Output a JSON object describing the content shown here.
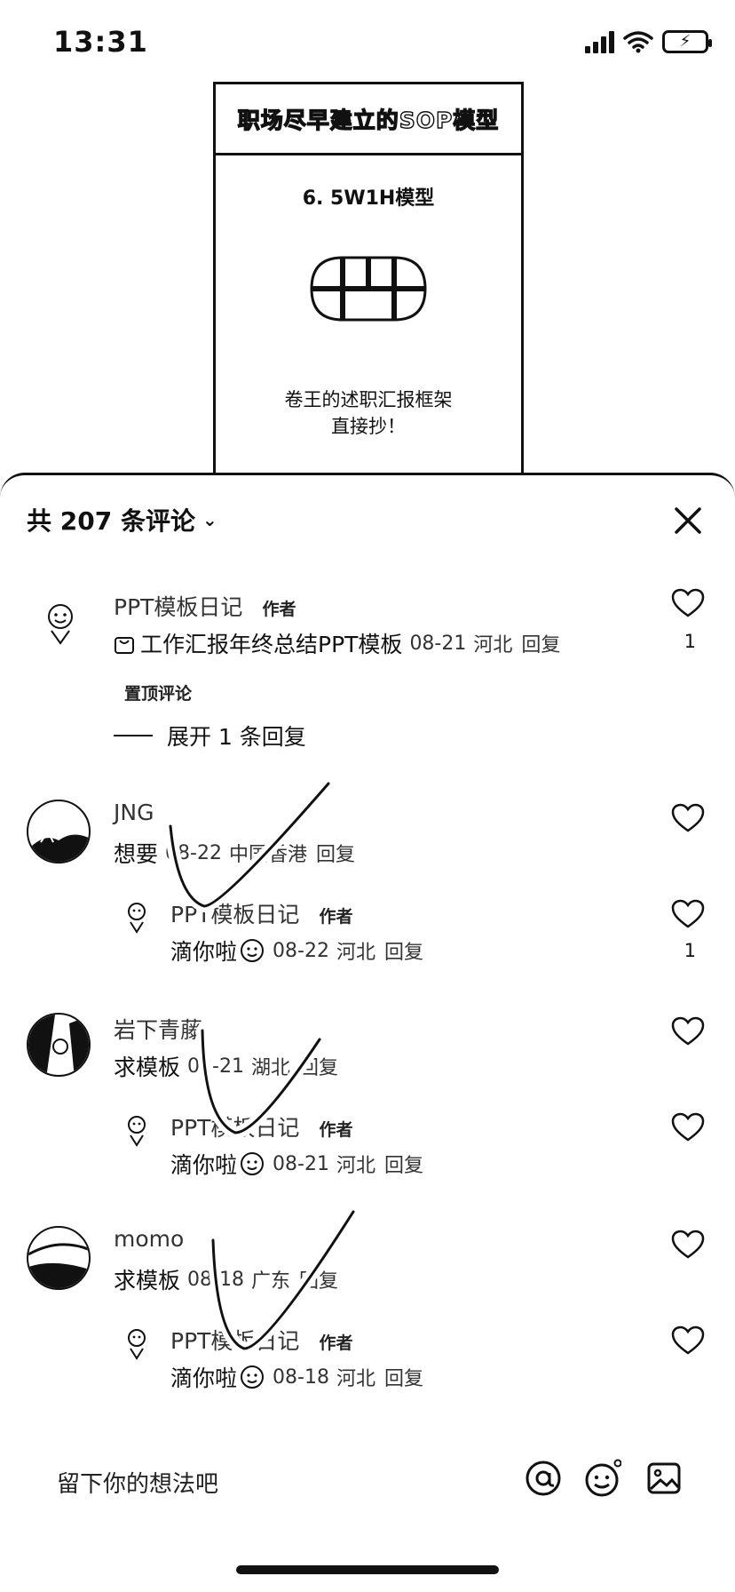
{
  "status_bar": {
    "time": "13:31"
  },
  "card": {
    "title": "职场尽早建立的SOP模型",
    "subtitle": "6. 5W1H模型",
    "caption_line1": "卷王的述职汇报框架",
    "caption_line2": "直接抄！"
  },
  "sheet": {
    "count_label": "共 207 条评论",
    "close_icon": "close-icon"
  },
  "comments": [
    {
      "name": "PPT模板日记",
      "badge": "作者",
      "text": "工作汇报年终总结PPT模板",
      "date": "08-21",
      "location": "河北",
      "reply": "回复",
      "likes": "1",
      "pinned": "置顶评论",
      "expand": "展开 1 条回复"
    },
    {
      "name": "JNG",
      "text": "想要",
      "date": "08-22",
      "location": "中国香港",
      "reply": "回复",
      "sub": {
        "name": "PPT模板日记",
        "badge": "作者",
        "text": "滴你啦",
        "date": "08-22",
        "location": "河北",
        "reply": "回复",
        "likes": "1"
      }
    },
    {
      "name": "岩下青藤",
      "text": "求模板",
      "date": "08-21",
      "location": "湖北",
      "reply": "回复",
      "sub": {
        "name": "PPT模板日记",
        "badge": "作者",
        "text": "滴你啦",
        "date": "08-21",
        "location": "河北",
        "reply": "回复"
      }
    },
    {
      "name": "momo",
      "text": "求模板",
      "date": "08-18",
      "location": "广东",
      "reply": "回复",
      "sub": {
        "name": "PPT模板日记",
        "badge": "作者",
        "text": "滴你啦",
        "date": "08-18",
        "location": "河北",
        "reply": "回复"
      }
    }
  ],
  "input": {
    "placeholder": "留下你的想法吧"
  }
}
